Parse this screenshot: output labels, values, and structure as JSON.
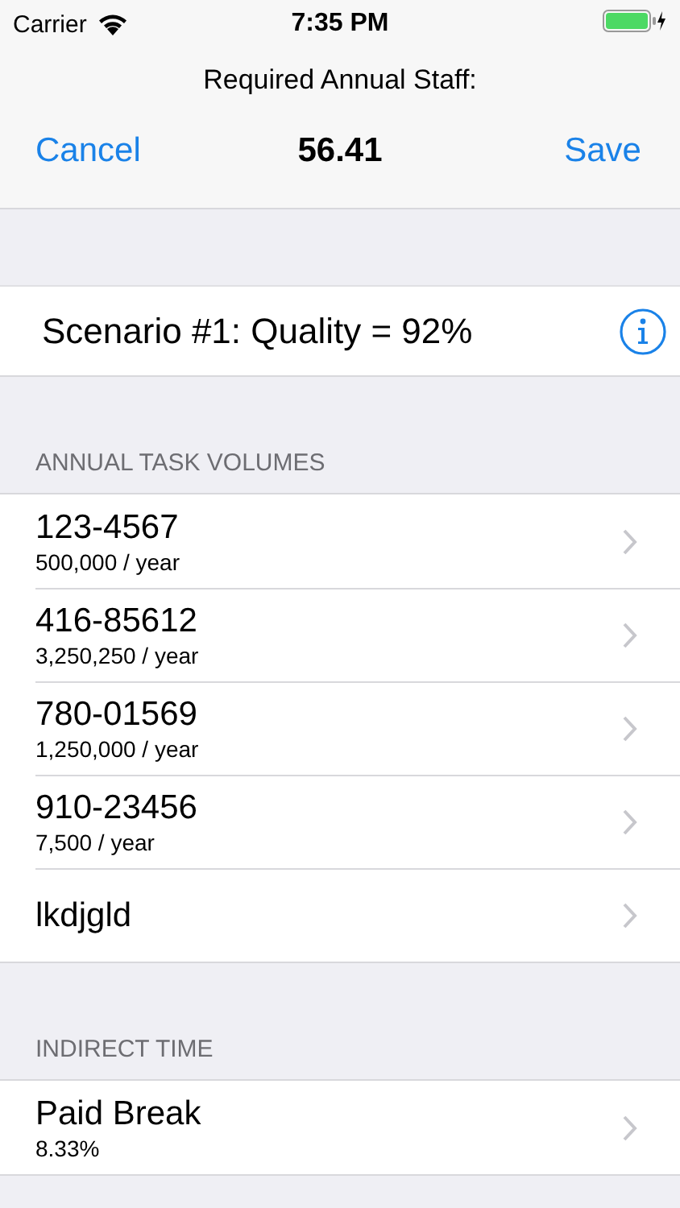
{
  "status_bar": {
    "carrier": "Carrier",
    "time": "7:35 PM"
  },
  "nav": {
    "prompt": "Required Annual Staff:",
    "value": "56.41",
    "left_button": "Cancel",
    "right_button": "Save"
  },
  "scenario": {
    "title": "Scenario #1: Quality = 92%"
  },
  "sections": [
    {
      "header": "ANNUAL TASK VOLUMES",
      "rows": [
        {
          "title": "123-4567",
          "subtitle": "500,000 / year"
        },
        {
          "title": "416-85612",
          "subtitle": "3,250,250 / year"
        },
        {
          "title": "780-01569",
          "subtitle": "1,250,000 / year"
        },
        {
          "title": "910-23456",
          "subtitle": "7,500 / year"
        },
        {
          "title": "lkdjgld"
        }
      ]
    },
    {
      "header": "INDIRECT TIME",
      "rows": [
        {
          "title": "Paid Break",
          "subtitle": "8.33%"
        }
      ]
    }
  ]
}
